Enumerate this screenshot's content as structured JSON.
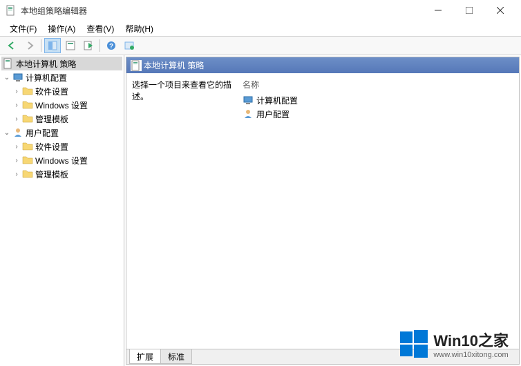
{
  "window": {
    "title": "本地组策略编辑器"
  },
  "menu": {
    "file": "文件(F)",
    "action": "操作(A)",
    "view": "查看(V)",
    "help": "帮助(H)"
  },
  "tree": {
    "root": "本地计算机 策略",
    "computer": "计算机配置",
    "software1": "软件设置",
    "windows1": "Windows 设置",
    "admin1": "管理模板",
    "user": "用户配置",
    "software2": "软件设置",
    "windows2": "Windows 设置",
    "admin2": "管理模板"
  },
  "right": {
    "title": "本地计算机 策略",
    "description": "选择一个项目来查看它的描述。",
    "columnName": "名称",
    "items": {
      "computer": "计算机配置",
      "user": "用户配置"
    }
  },
  "tabs": {
    "extended": "扩展",
    "standard": "标准"
  },
  "watermark": {
    "title": "Win10之家",
    "url": "www.win10xitong.com"
  }
}
